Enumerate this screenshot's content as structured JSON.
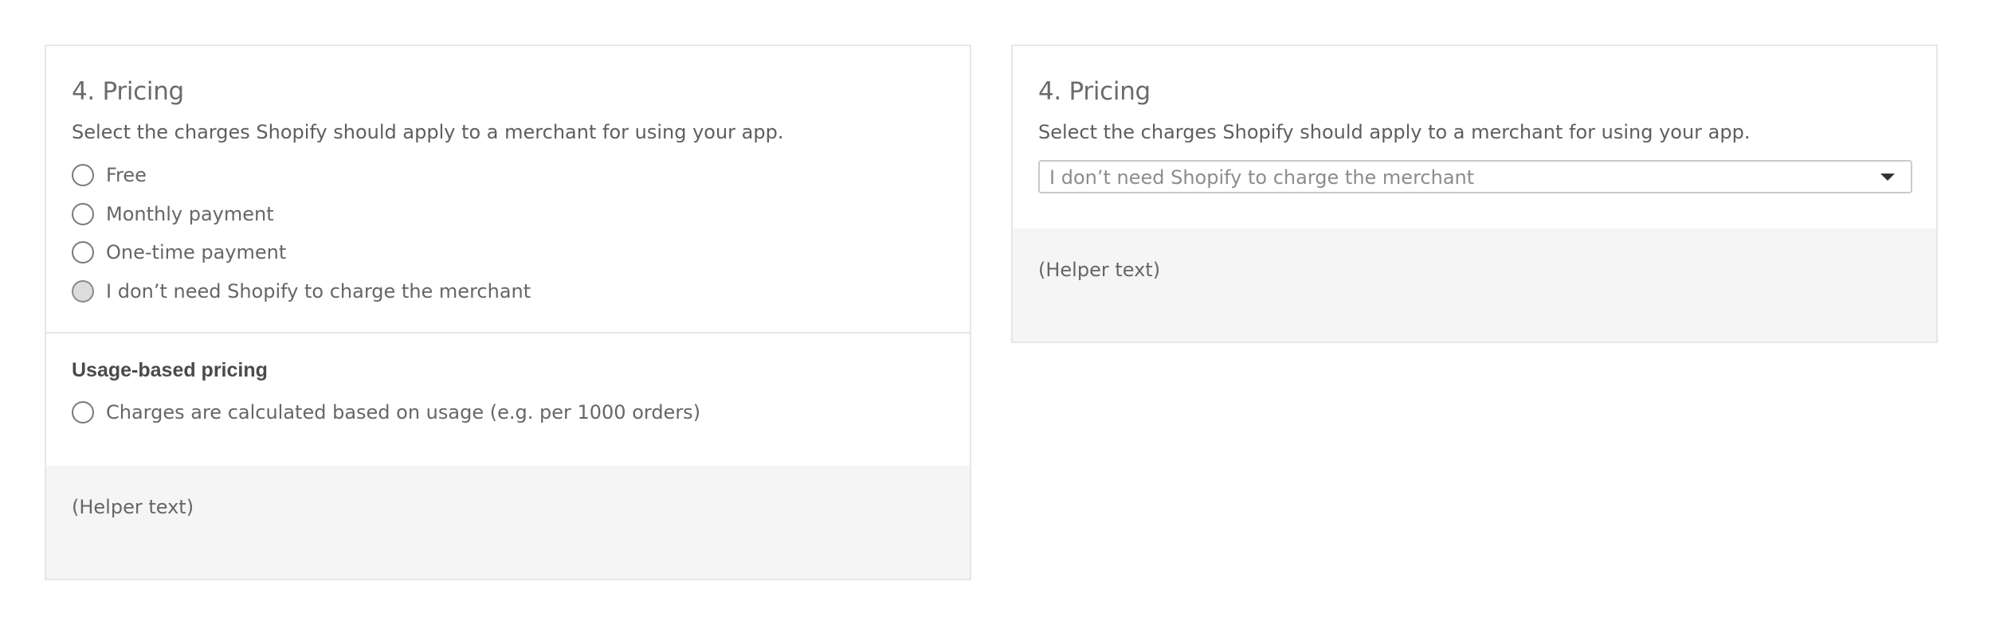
{
  "left_card": {
    "title": "4. Pricing",
    "description": "Select the charges Shopify should apply to a merchant for using your app.",
    "options": [
      {
        "label": "Free",
        "selected": false
      },
      {
        "label": "Monthly payment",
        "selected": false
      },
      {
        "label": "One-time payment",
        "selected": false
      },
      {
        "label": "I don’t need Shopify to charge the merchant",
        "selected": true
      }
    ],
    "usage_heading": "Usage-based pricing",
    "usage_option": {
      "label": "Charges are calculated based on usage (e.g. per 1000 orders)",
      "selected": false
    },
    "helper_text": "(Helper text)"
  },
  "right_card": {
    "title": "4. Pricing",
    "description": "Select the charges Shopify should apply to a merchant for using your app.",
    "select_value": "I don’t need Shopify to charge the merchant",
    "helper_text": "(Helper text)"
  },
  "icons": {
    "radio": "radio-circle-icon",
    "dropdown": "chevron-down-icon"
  },
  "colors": {
    "border": "#e6e6e6",
    "helper_background": "#f5f5f5",
    "selected_radio_fill": "#dcdcdc"
  }
}
